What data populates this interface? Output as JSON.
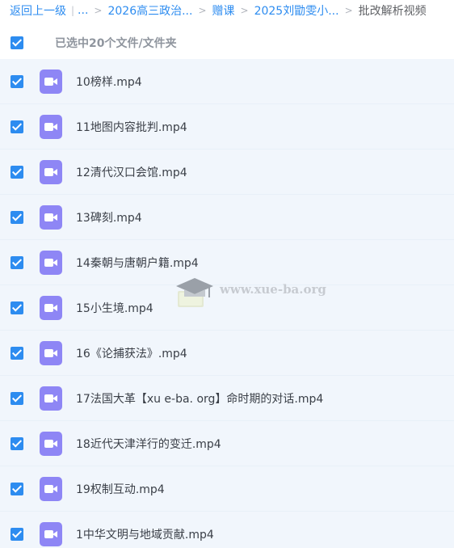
{
  "breadcrumb": {
    "back": "返回上一级",
    "ellipsis": "...",
    "items": [
      "2026高三政治...",
      "赠课",
      "2025刘勖雯小..."
    ],
    "current": "批改解析视频"
  },
  "selection": {
    "label": "已选中20个文件/文件夹"
  },
  "files": [
    {
      "name": "10榜样.mp4"
    },
    {
      "name": "11地图内容批判.mp4"
    },
    {
      "name": "12清代汉口会馆.mp4"
    },
    {
      "name": "13碑刻.mp4"
    },
    {
      "name": "14秦朝与唐朝户籍.mp4"
    },
    {
      "name": "15小生境.mp4"
    },
    {
      "name": "16《论捕获法》.mp4"
    },
    {
      "name": "17法国大革【xu e-ba. org】命时期的对话.mp4"
    },
    {
      "name": "18近代天津洋行的变迁.mp4"
    },
    {
      "name": "19权制互动.mp4"
    },
    {
      "name": "1中华文明与地域贡献.mp4"
    }
  ],
  "watermark": {
    "text": "www.xue-ba.org"
  },
  "colors": {
    "accent": "#2d8cf0",
    "video_icon": "#8e86f5",
    "row_background": "#f1f6fc"
  }
}
